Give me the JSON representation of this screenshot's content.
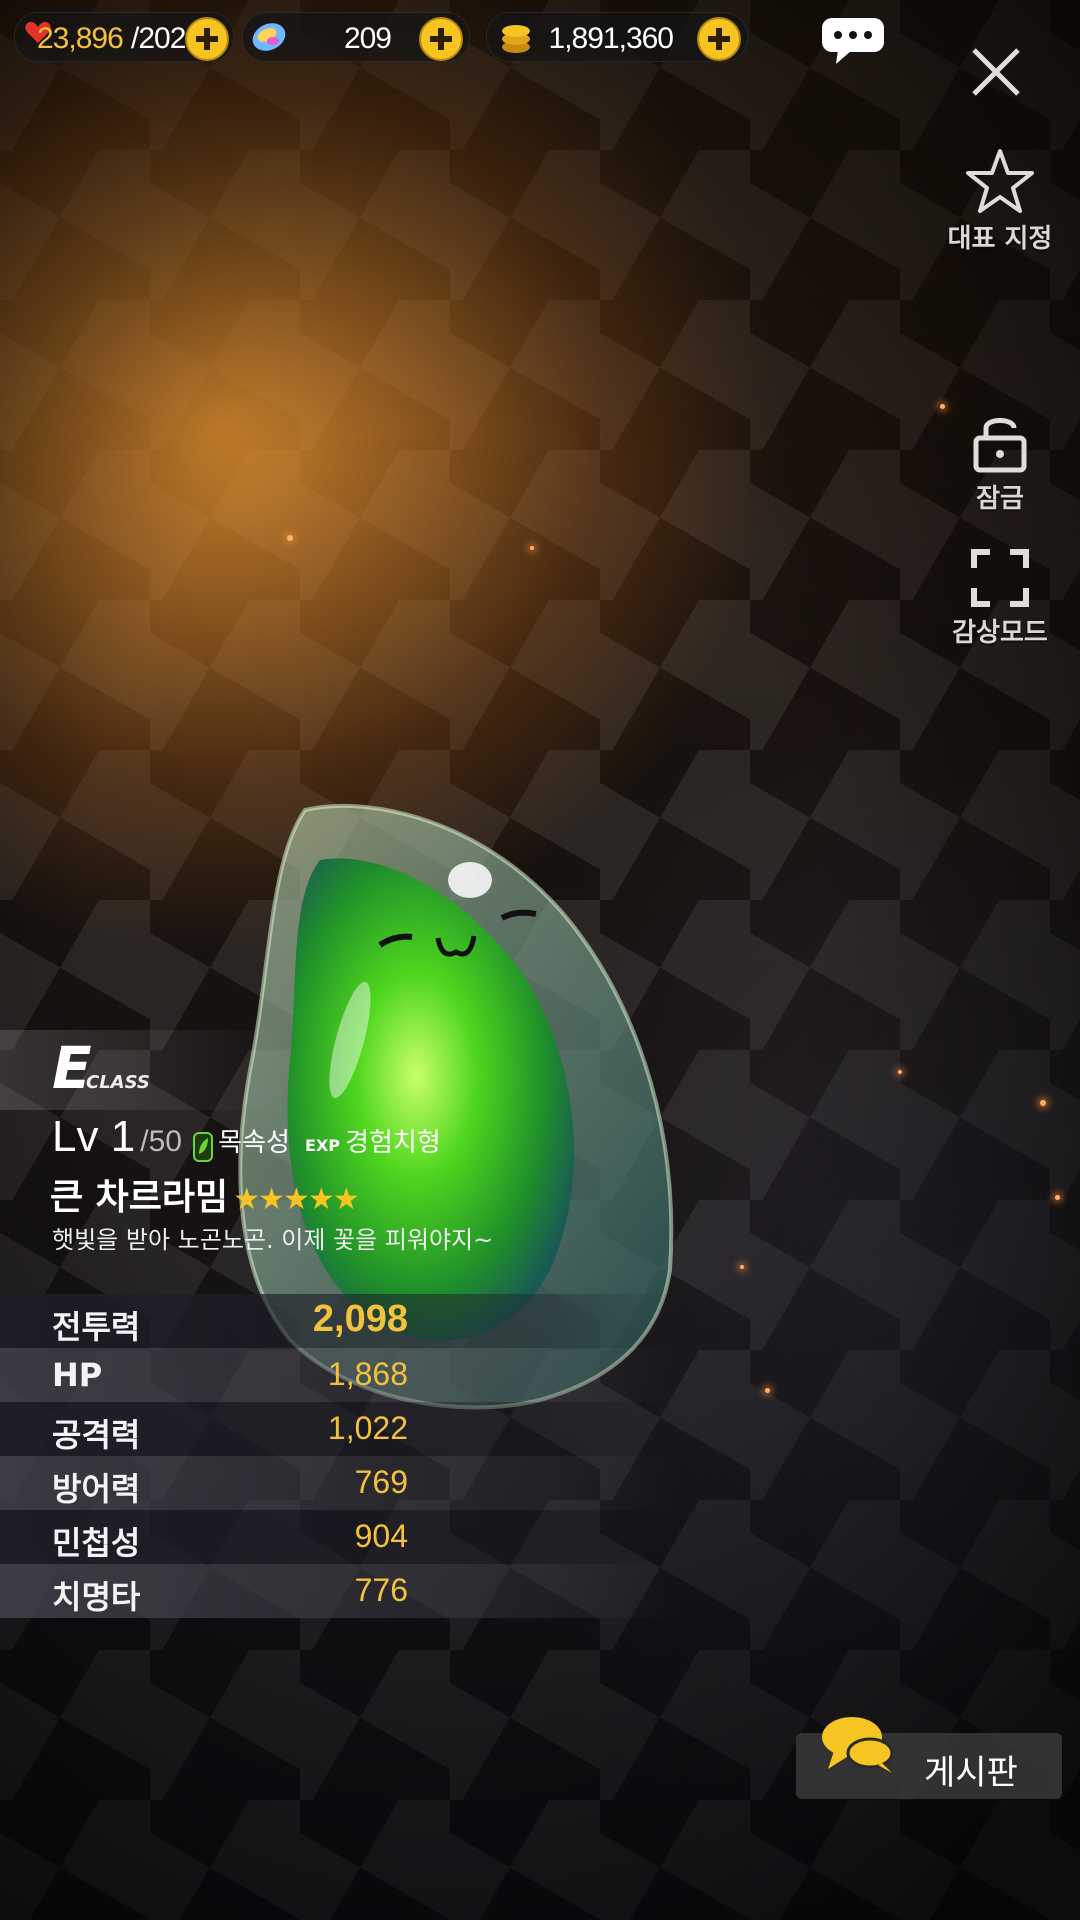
{
  "topbar": {
    "stamina_current": "23,896",
    "stamina_max": "/202",
    "gems": "209",
    "gold": "1,891,360"
  },
  "side": {
    "favorite_label": "대표 지정",
    "lock_label": "잠금",
    "view_mode_label": "감상모드"
  },
  "character": {
    "class_letter": "E",
    "class_word": "CLASS",
    "level_prefix": "Lv 1",
    "level_max": "/50",
    "element": "목속성",
    "exp_prefix": "EXP",
    "type": "경험치형",
    "name": "큰 차르라밈",
    "stars": "★★★★★",
    "description": "햇빛을 받아 노곤노곤. 이제 꽃을 피워야지~"
  },
  "stats": [
    {
      "label": "전투력",
      "value": "2,098"
    },
    {
      "label": "HP",
      "value": "1,868"
    },
    {
      "label": "공격력",
      "value": "1,022"
    },
    {
      "label": "방어력",
      "value": "769"
    },
    {
      "label": "민첩성",
      "value": "904"
    },
    {
      "label": "치명타",
      "value": "776"
    }
  ],
  "board_label": "게시판",
  "colors": {
    "accent": "#f6c521",
    "slime": "#39c21a"
  }
}
